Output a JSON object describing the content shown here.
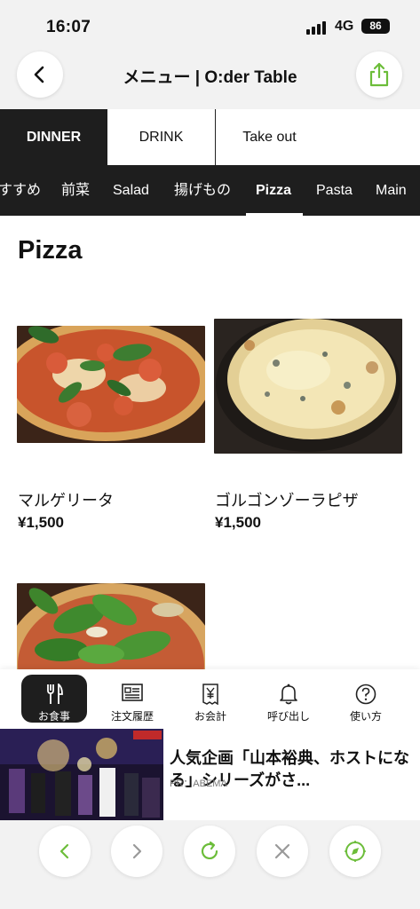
{
  "status_bar": {
    "time": "16:07",
    "network": "4G",
    "battery": "86"
  },
  "header": {
    "title": "メニュー | O:der Table"
  },
  "main_tabs": [
    {
      "label": "DINNER",
      "active": true
    },
    {
      "label": "DRINK",
      "active": false
    },
    {
      "label": "Take out",
      "active": false
    }
  ],
  "categories": [
    {
      "label": "すすめ",
      "active": false
    },
    {
      "label": "前菜",
      "active": false
    },
    {
      "label": "Salad",
      "active": false
    },
    {
      "label": "揚げもの",
      "active": false
    },
    {
      "label": "Pizza",
      "active": true
    },
    {
      "label": "Pasta",
      "active": false
    },
    {
      "label": "Main",
      "active": false
    }
  ],
  "section_title": "Pizza",
  "products": [
    {
      "name": "マルゲリータ",
      "price": "¥1,500"
    },
    {
      "name": "ゴルゴンゾーラピザ",
      "price": "¥1,500"
    },
    {
      "name": "",
      "price": ""
    }
  ],
  "bottom_nav": [
    {
      "label": "お食事",
      "icon": "fork-knife-icon",
      "active": true
    },
    {
      "label": "注文履歴",
      "icon": "receipt-icon",
      "active": false
    },
    {
      "label": "お会計",
      "icon": "yen-receipt-icon",
      "active": false
    },
    {
      "label": "呼び出し",
      "icon": "bell-icon",
      "active": false
    },
    {
      "label": "使い方",
      "icon": "question-icon",
      "active": false
    }
  ],
  "ad": {
    "text": "人気企画「山本裕典、ホストになる」シリーズがさ...",
    "source": "PR：ABEMA"
  },
  "browser_controls": [
    "back-icon",
    "forward-icon",
    "reload-icon",
    "close-icon",
    "compass-icon"
  ],
  "colors": {
    "dark": "#1e1e1e",
    "accent_green": "#6cbd3a",
    "page_bg": "#ffffff"
  }
}
